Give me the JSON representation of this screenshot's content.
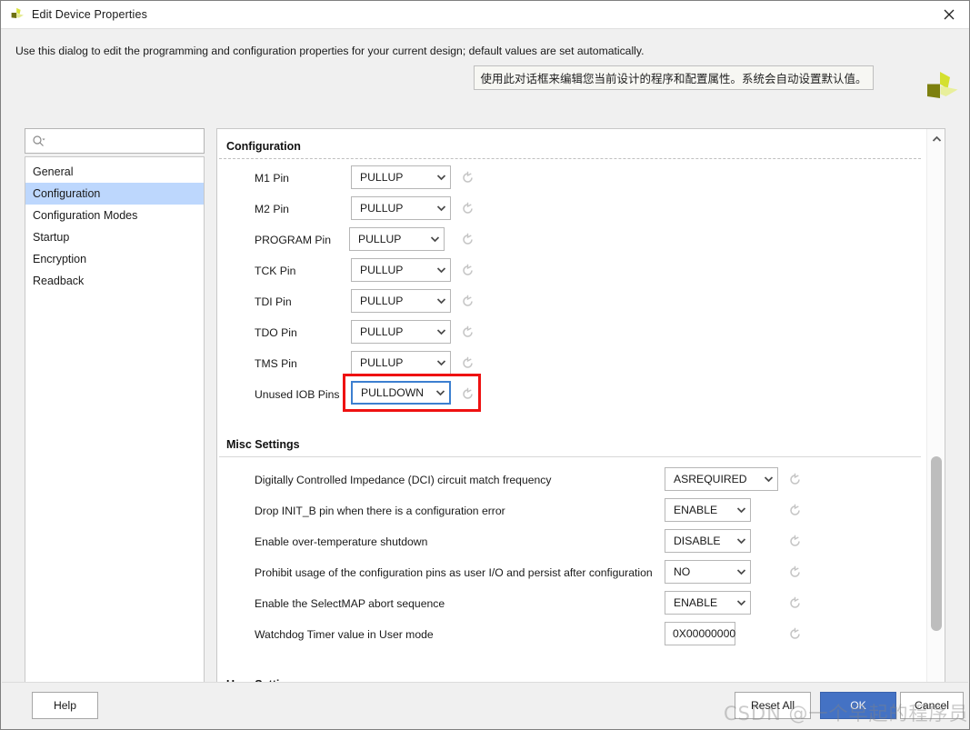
{
  "window": {
    "title": "Edit Device Properties",
    "close_label": "×",
    "logo_name": "xilinx-logo"
  },
  "header": {
    "hint": "Use this dialog to edit the programming and configuration properties for your current design; default values are set automatically.",
    "tooltip_cn": "使用此对话框来编辑您当前设计的程序和配置属性。系统会自动设置默认值。"
  },
  "search": {
    "value": "",
    "placeholder": ""
  },
  "sidebar": {
    "items": [
      {
        "label": "General",
        "selected": false
      },
      {
        "label": "Configuration",
        "selected": true
      },
      {
        "label": "Configuration Modes",
        "selected": false
      },
      {
        "label": "Startup",
        "selected": false
      },
      {
        "label": "Encryption",
        "selected": false
      },
      {
        "label": "Readback",
        "selected": false
      }
    ]
  },
  "main": {
    "sections": [
      {
        "id": "configuration",
        "title": "Configuration"
      },
      {
        "id": "misc",
        "title": "Misc Settings"
      },
      {
        "id": "user",
        "title": "User Settings"
      }
    ],
    "configuration_rows": [
      {
        "label": "M1 Pin",
        "value": "PULLUP",
        "highlighted": false
      },
      {
        "label": "M2 Pin",
        "value": "PULLUP",
        "highlighted": false
      },
      {
        "label": "PROGRAM Pin",
        "value": "PULLUP",
        "highlighted": false
      },
      {
        "label": "TCK Pin",
        "value": "PULLUP",
        "highlighted": false
      },
      {
        "label": "TDI Pin",
        "value": "PULLUP",
        "highlighted": false
      },
      {
        "label": "TDO Pin",
        "value": "PULLUP",
        "highlighted": false
      },
      {
        "label": "TMS Pin",
        "value": "PULLUP",
        "highlighted": false
      },
      {
        "label": "Unused IOB Pins",
        "value": "PULLDOWN",
        "highlighted": true
      }
    ],
    "misc_rows": [
      {
        "label": "Digitally Controlled Impedance (DCI) circuit match frequency",
        "value": "ASREQUIRED",
        "type": "combo"
      },
      {
        "label": "Drop INIT_B pin when there is a configuration error",
        "value": "ENABLE",
        "type": "combo"
      },
      {
        "label": "Enable over-temperature shutdown",
        "value": "DISABLE",
        "type": "combo"
      },
      {
        "label": "Prohibit usage of the configuration pins as user I/O and persist after configuration",
        "value": "NO",
        "type": "combo"
      },
      {
        "label": "Enable the SelectMAP abort sequence",
        "value": "ENABLE",
        "type": "combo"
      },
      {
        "label": "Watchdog Timer value in User mode",
        "value": "0X00000000",
        "type": "text"
      }
    ]
  },
  "scrollbar": {
    "up_arrow": "▲",
    "down_arrow": "▼"
  },
  "footer": {
    "help": "Help",
    "reset_all": "Reset All",
    "ok": "OK",
    "cancel": "Cancel"
  },
  "overlay": {
    "watermark": "CSDN @一个早起的程序员"
  },
  "colors": {
    "selection": "#bdd7fd",
    "primary_button": "#4472c4",
    "highlight_box": "#ee1111",
    "focus_border": "#3c7fd0",
    "brand": "#c8d32a"
  }
}
